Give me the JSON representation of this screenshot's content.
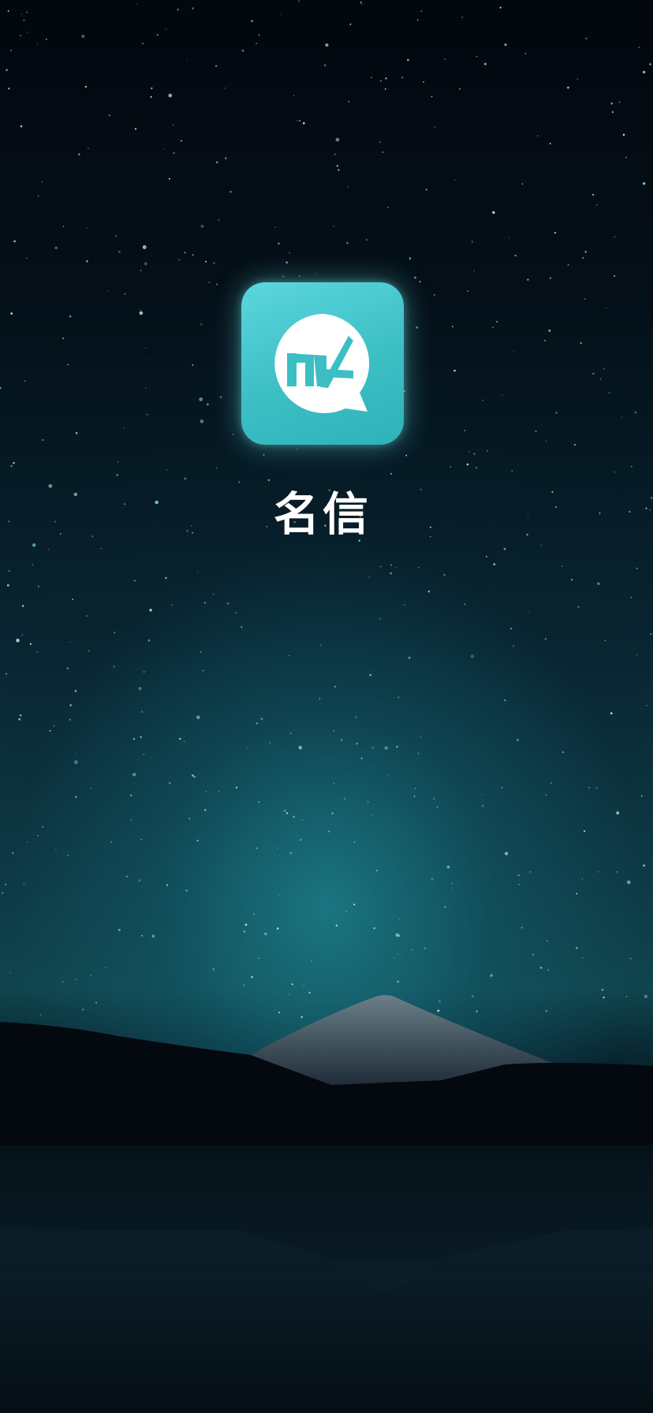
{
  "app": {
    "name": "名信",
    "logo_text": "MX",
    "icon": "mx-chat-bubble-logo"
  },
  "background": {
    "scene": "starry-night-mountain-lake",
    "colors": {
      "sky_top": "#03070e",
      "glow": "#1c7e8a",
      "icon_bg": "#3cbfc4",
      "icon_fg": "#ffffff"
    }
  }
}
